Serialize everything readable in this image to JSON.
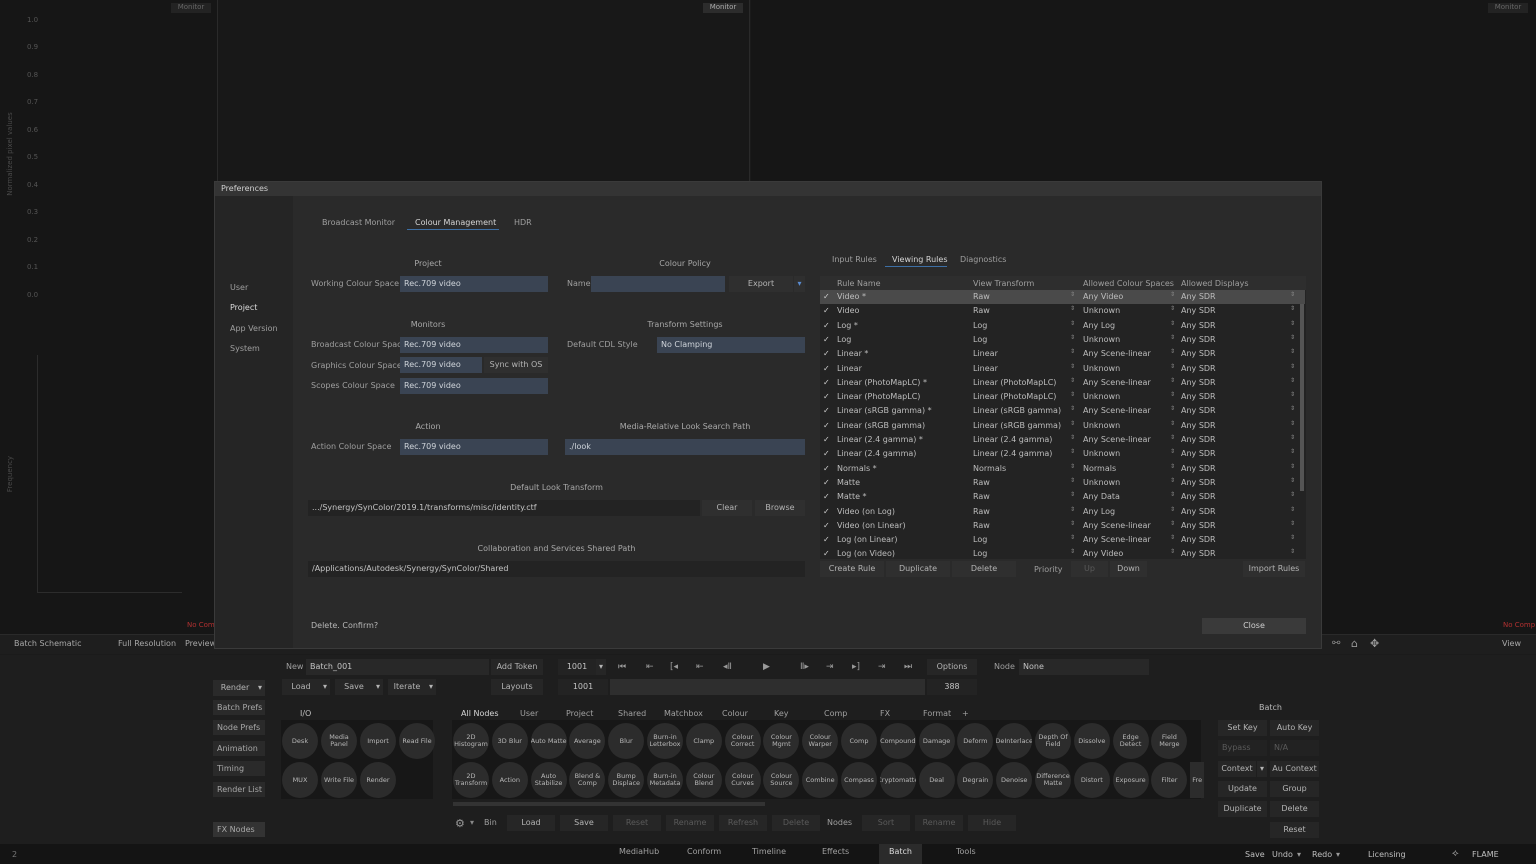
{
  "background": {
    "monitor_left": "Monitor",
    "monitor_center": "Monitor",
    "monitor_right": "Monitor",
    "y_ticks": [
      "1.0",
      "0.9",
      "0.8",
      "0.7",
      "0.6",
      "0.5",
      "0.4",
      "0.3",
      "0.2",
      "0.1",
      "0.0"
    ],
    "y_label_top": "Normalized pixel values",
    "y_label_bottom": "Frequency",
    "no_comp_left": "No Comp",
    "no_comp_right": "No Comp"
  },
  "dialog": {
    "title": "Preferences",
    "sidebar": [
      "User",
      "Project",
      "App Version",
      "System"
    ],
    "tabs": [
      "Broadcast Monitor",
      "Colour Management",
      "HDR"
    ],
    "project_header": "Project",
    "working_label": "Working Colour Space",
    "working_value": "Rec.709 video",
    "policy_header": "Colour Policy",
    "name_label": "Name",
    "name_value": "",
    "export_btn": "Export",
    "monitors_header": "Monitors",
    "broadcast_label": "Broadcast Colour Space",
    "broadcast_value": "Rec.709 video",
    "graphics_label": "Graphics Colour Space",
    "graphics_value": "Rec.709 video",
    "sync_btn": "Sync with OS",
    "scopes_label": "Scopes Colour Space",
    "scopes_value": "Rec.709 video",
    "transform_header": "Transform Settings",
    "cdl_label": "Default CDL Style",
    "cdl_value": "No Clamping",
    "action_header": "Action",
    "action_label": "Action Colour Space",
    "action_value": "Rec.709 video",
    "look_header": "Media-Relative Look Search Path",
    "look_value": "./look",
    "default_look_header": "Default Look Transform",
    "default_look_value": ".../Synergy/SynColor/2019.1/transforms/misc/identity.ctf",
    "clear_btn": "Clear",
    "browse_btn": "Browse",
    "collab_header": "Collaboration and Services Shared Path",
    "collab_value": "/Applications/Autodesk/Synergy/SynColor/Shared",
    "status": "Delete. Confirm?",
    "close_btn": "Close",
    "rules_tabs": [
      "Input Rules",
      "Viewing Rules",
      "Diagnostics"
    ],
    "table_headers": [
      "Rule Name",
      "View Transform",
      "Allowed Colour Spaces",
      "Allowed Displays"
    ],
    "rows": [
      [
        "Video *",
        "Raw",
        "Any Video",
        "Any SDR"
      ],
      [
        "Video",
        "Raw",
        "Unknown",
        "Any SDR"
      ],
      [
        "Log *",
        "Log",
        "Any Log",
        "Any SDR"
      ],
      [
        "Log",
        "Log",
        "Unknown",
        "Any SDR"
      ],
      [
        "Linear *",
        "Linear",
        "Any Scene-linear",
        "Any SDR"
      ],
      [
        "Linear",
        "Linear",
        "Unknown",
        "Any SDR"
      ],
      [
        "Linear (PhotoMapLC) *",
        "Linear (PhotoMapLC)",
        "Any Scene-linear",
        "Any SDR"
      ],
      [
        "Linear (PhotoMapLC)",
        "Linear (PhotoMapLC)",
        "Unknown",
        "Any SDR"
      ],
      [
        "Linear (sRGB gamma) *",
        "Linear (sRGB gamma)",
        "Any Scene-linear",
        "Any SDR"
      ],
      [
        "Linear (sRGB gamma)",
        "Linear (sRGB gamma)",
        "Unknown",
        "Any SDR"
      ],
      [
        "Linear (2.4 gamma) *",
        "Linear (2.4 gamma)",
        "Any Scene-linear",
        "Any SDR"
      ],
      [
        "Linear (2.4 gamma)",
        "Linear (2.4 gamma)",
        "Unknown",
        "Any SDR"
      ],
      [
        "Normals *",
        "Normals",
        "Normals",
        "Any SDR"
      ],
      [
        "Matte",
        "Raw",
        "Unknown",
        "Any SDR"
      ],
      [
        "Matte *",
        "Raw",
        "Any Data",
        "Any SDR"
      ],
      [
        "Video (on Log)",
        "Raw",
        "Any Log",
        "Any SDR"
      ],
      [
        "Video (on Linear)",
        "Raw",
        "Any Scene-linear",
        "Any SDR"
      ],
      [
        "Log (on Linear)",
        "Log",
        "Any Scene-linear",
        "Any SDR"
      ],
      [
        "Log (on Video)",
        "Log",
        "Any Video",
        "Any SDR"
      ]
    ],
    "create_rule_btn": "Create Rule",
    "duplicate_btn": "Duplicate",
    "delete_btn": "Delete",
    "priority_label": "Priority",
    "up_btn": "Up",
    "down_btn": "Down",
    "import_rules_btn": "Import Rules"
  },
  "viewerbar": {
    "batch_schematic": "Batch Schematic",
    "full_resolution": "Full Resolution",
    "preview": "Preview",
    "view": "View"
  },
  "batch": {
    "new_label": "New",
    "batch_name": "Batch_001",
    "add_token": "Add Token",
    "frame": "1001",
    "options": "Options",
    "node_label": "Node",
    "node_value": "None",
    "render": "Render",
    "load": "Load",
    "save": "Save",
    "iterate": "Iterate",
    "layouts": "Layouts",
    "start_frame": "1001",
    "end_frame": "388",
    "side_buttons": [
      "Batch Prefs",
      "Node Prefs",
      "Animation",
      "Timing",
      "Render List"
    ],
    "fx_nodes": "FX Nodes",
    "io_label": "I/O",
    "io_nodes_row1": [
      "Desk",
      "Media Panel",
      "Import",
      "Read File"
    ],
    "io_nodes_row2": [
      "MUX",
      "Write File",
      "Render"
    ],
    "node_tabs": [
      "All Nodes",
      "User",
      "Project",
      "Shared",
      "Matchbox",
      "Colour",
      "Key",
      "Comp",
      "FX",
      "Format",
      "+"
    ],
    "nodes_row1": [
      "2D Histogram",
      "3D Blur",
      "Auto Matte",
      "Average",
      "Blur",
      "Burn-in Letterbox",
      "Clamp",
      "Colour Correct",
      "Colour Mgmt",
      "Colour Warper",
      "Comp",
      "Compound",
      "Damage",
      "Deform",
      "DeInterlace",
      "Depth Of Field",
      "Dissolve",
      "Edge Detect",
      "Field Merge"
    ],
    "nodes_row2": [
      "2D Transform",
      "Action",
      "Auto Stabilize",
      "Blend & Comp",
      "Bump Displace",
      "Burn-in Metadata",
      "Colour Blend",
      "Colour Curves",
      "Colour Source",
      "Combine",
      "Compass",
      "Cryptomatte",
      "Deal",
      "Degrain",
      "Denoise",
      "Difference Matte",
      "Distort",
      "Exposure",
      "Filter",
      "Fre"
    ],
    "bin_label": "Bin",
    "bin_load": "Load",
    "bin_save": "Save",
    "bin_reset": "Reset",
    "bin_rename": "Rename",
    "bin_refresh": "Refresh",
    "bin_delete": "Delete",
    "nodes_label": "Nodes",
    "nodes_sort": "Sort",
    "nodes_rename": "Rename",
    "nodes_hide": "Hide",
    "batch_header": "Batch",
    "set_key": "Set Key",
    "auto_key": "Auto Key",
    "bypass": "Bypass",
    "na": "N/A",
    "context": "Context",
    "au_context": "Au Context",
    "update": "Update",
    "group": "Group",
    "duplicate": "Duplicate",
    "delete": "Delete",
    "reset": "Reset"
  },
  "bottom": {
    "tabs": [
      "MediaHub",
      "Conform",
      "Timeline",
      "Effects",
      "Batch",
      "Tools"
    ],
    "save": "Save",
    "undo": "Undo",
    "redo": "Redo",
    "licensing": "Licensing",
    "brand": "FLAME",
    "frame_indicator": "2"
  }
}
